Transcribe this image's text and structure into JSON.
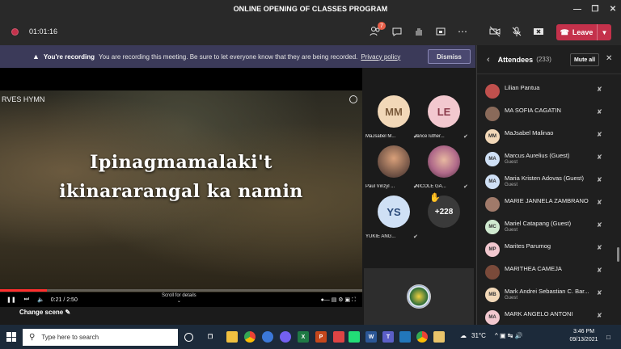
{
  "window": {
    "title": "ONLINE OPENING OF CLASSES PROGRAM"
  },
  "toolbar": {
    "timer": "01:01:16",
    "notification_count": "7",
    "leave_label": "Leave"
  },
  "banner": {
    "heading": "You're recording",
    "message": "You are recording this meeting. Be sure to let everyone know that they are being recorded.",
    "link": "Privacy policy",
    "dismiss": "Dismiss"
  },
  "video": {
    "title": "RVES HYMN",
    "lyric_line1": "Ipinagmamalaki't",
    "lyric_line2": "ikinararangal ka namin",
    "time": "0:21 / 2:50",
    "progress_fraction": 0.13,
    "scroll_hint": "Scroll for details",
    "change_scene": "Change scene"
  },
  "tiles": [
    {
      "initials": "MM",
      "name": "MaJsabel M...",
      "color": "#f2d8b8",
      "text_color": "#7a5a3a"
    },
    {
      "initials": "LE",
      "name": "lance luther...",
      "color": "#f2c8cf",
      "text_color": "#8a3b4b"
    },
    {
      "initials": "",
      "name": "Paul Vinzyl ...",
      "color": "#7a5a4a",
      "text_color": "#fff",
      "photo": true
    },
    {
      "initials": "",
      "name": "NICOLE GA...",
      "color": "#b06a8a",
      "text_color": "#fff",
      "photo": true
    },
    {
      "initials": "YS",
      "name": "YUKIE ANG...",
      "color": "#cfe0f5",
      "text_color": "#2b4a7a"
    },
    {
      "initials": "+228",
      "name": "",
      "color": "#3a3a3a",
      "text_color": "#fff"
    }
  ],
  "panel": {
    "title": "Attendees",
    "count": "(233)",
    "mute_all": "Mute all",
    "attendees": [
      {
        "name": "Lilian Pantua",
        "sub": "",
        "initials": "",
        "color": "#c0504d"
      },
      {
        "name": "MA SOFIA CAGATIN",
        "sub": "",
        "initials": "",
        "color": "#8a6a5a"
      },
      {
        "name": "MaJsabel Malinao",
        "sub": "",
        "initials": "MM",
        "color": "#f2d8b8"
      },
      {
        "name": "Marcus Aurelius (Guest)",
        "sub": "Guest",
        "initials": "MA",
        "color": "#cfe0f5"
      },
      {
        "name": "Maria Kristen Adovas (Guest)",
        "sub": "Guest",
        "initials": "MA",
        "color": "#cfe0f5"
      },
      {
        "name": "MARIE JANNELA ZAMBRANO",
        "sub": "",
        "initials": "",
        "color": "#a07a6a"
      },
      {
        "name": "Mariel Catapang (Guest)",
        "sub": "Guest",
        "initials": "MC",
        "color": "#d0ead0"
      },
      {
        "name": "Marites Parumog",
        "sub": "",
        "initials": "MP",
        "color": "#f2c8cf"
      },
      {
        "name": "MARITHEA CAMEJA",
        "sub": "",
        "initials": "",
        "color": "#7a4a3a"
      },
      {
        "name": "Mark Andrei Sebastian C. Bar...",
        "sub": "Guest",
        "initials": "MB",
        "color": "#f2d8b8"
      },
      {
        "name": "MARK ANGELO ANTONI",
        "sub": "",
        "initials": "MA",
        "color": "#f2c8cf"
      }
    ]
  },
  "taskbar": {
    "search_placeholder": "Type here to search",
    "temperature": "31°C",
    "time": "3:46 PM",
    "date": "09/13/2021"
  }
}
